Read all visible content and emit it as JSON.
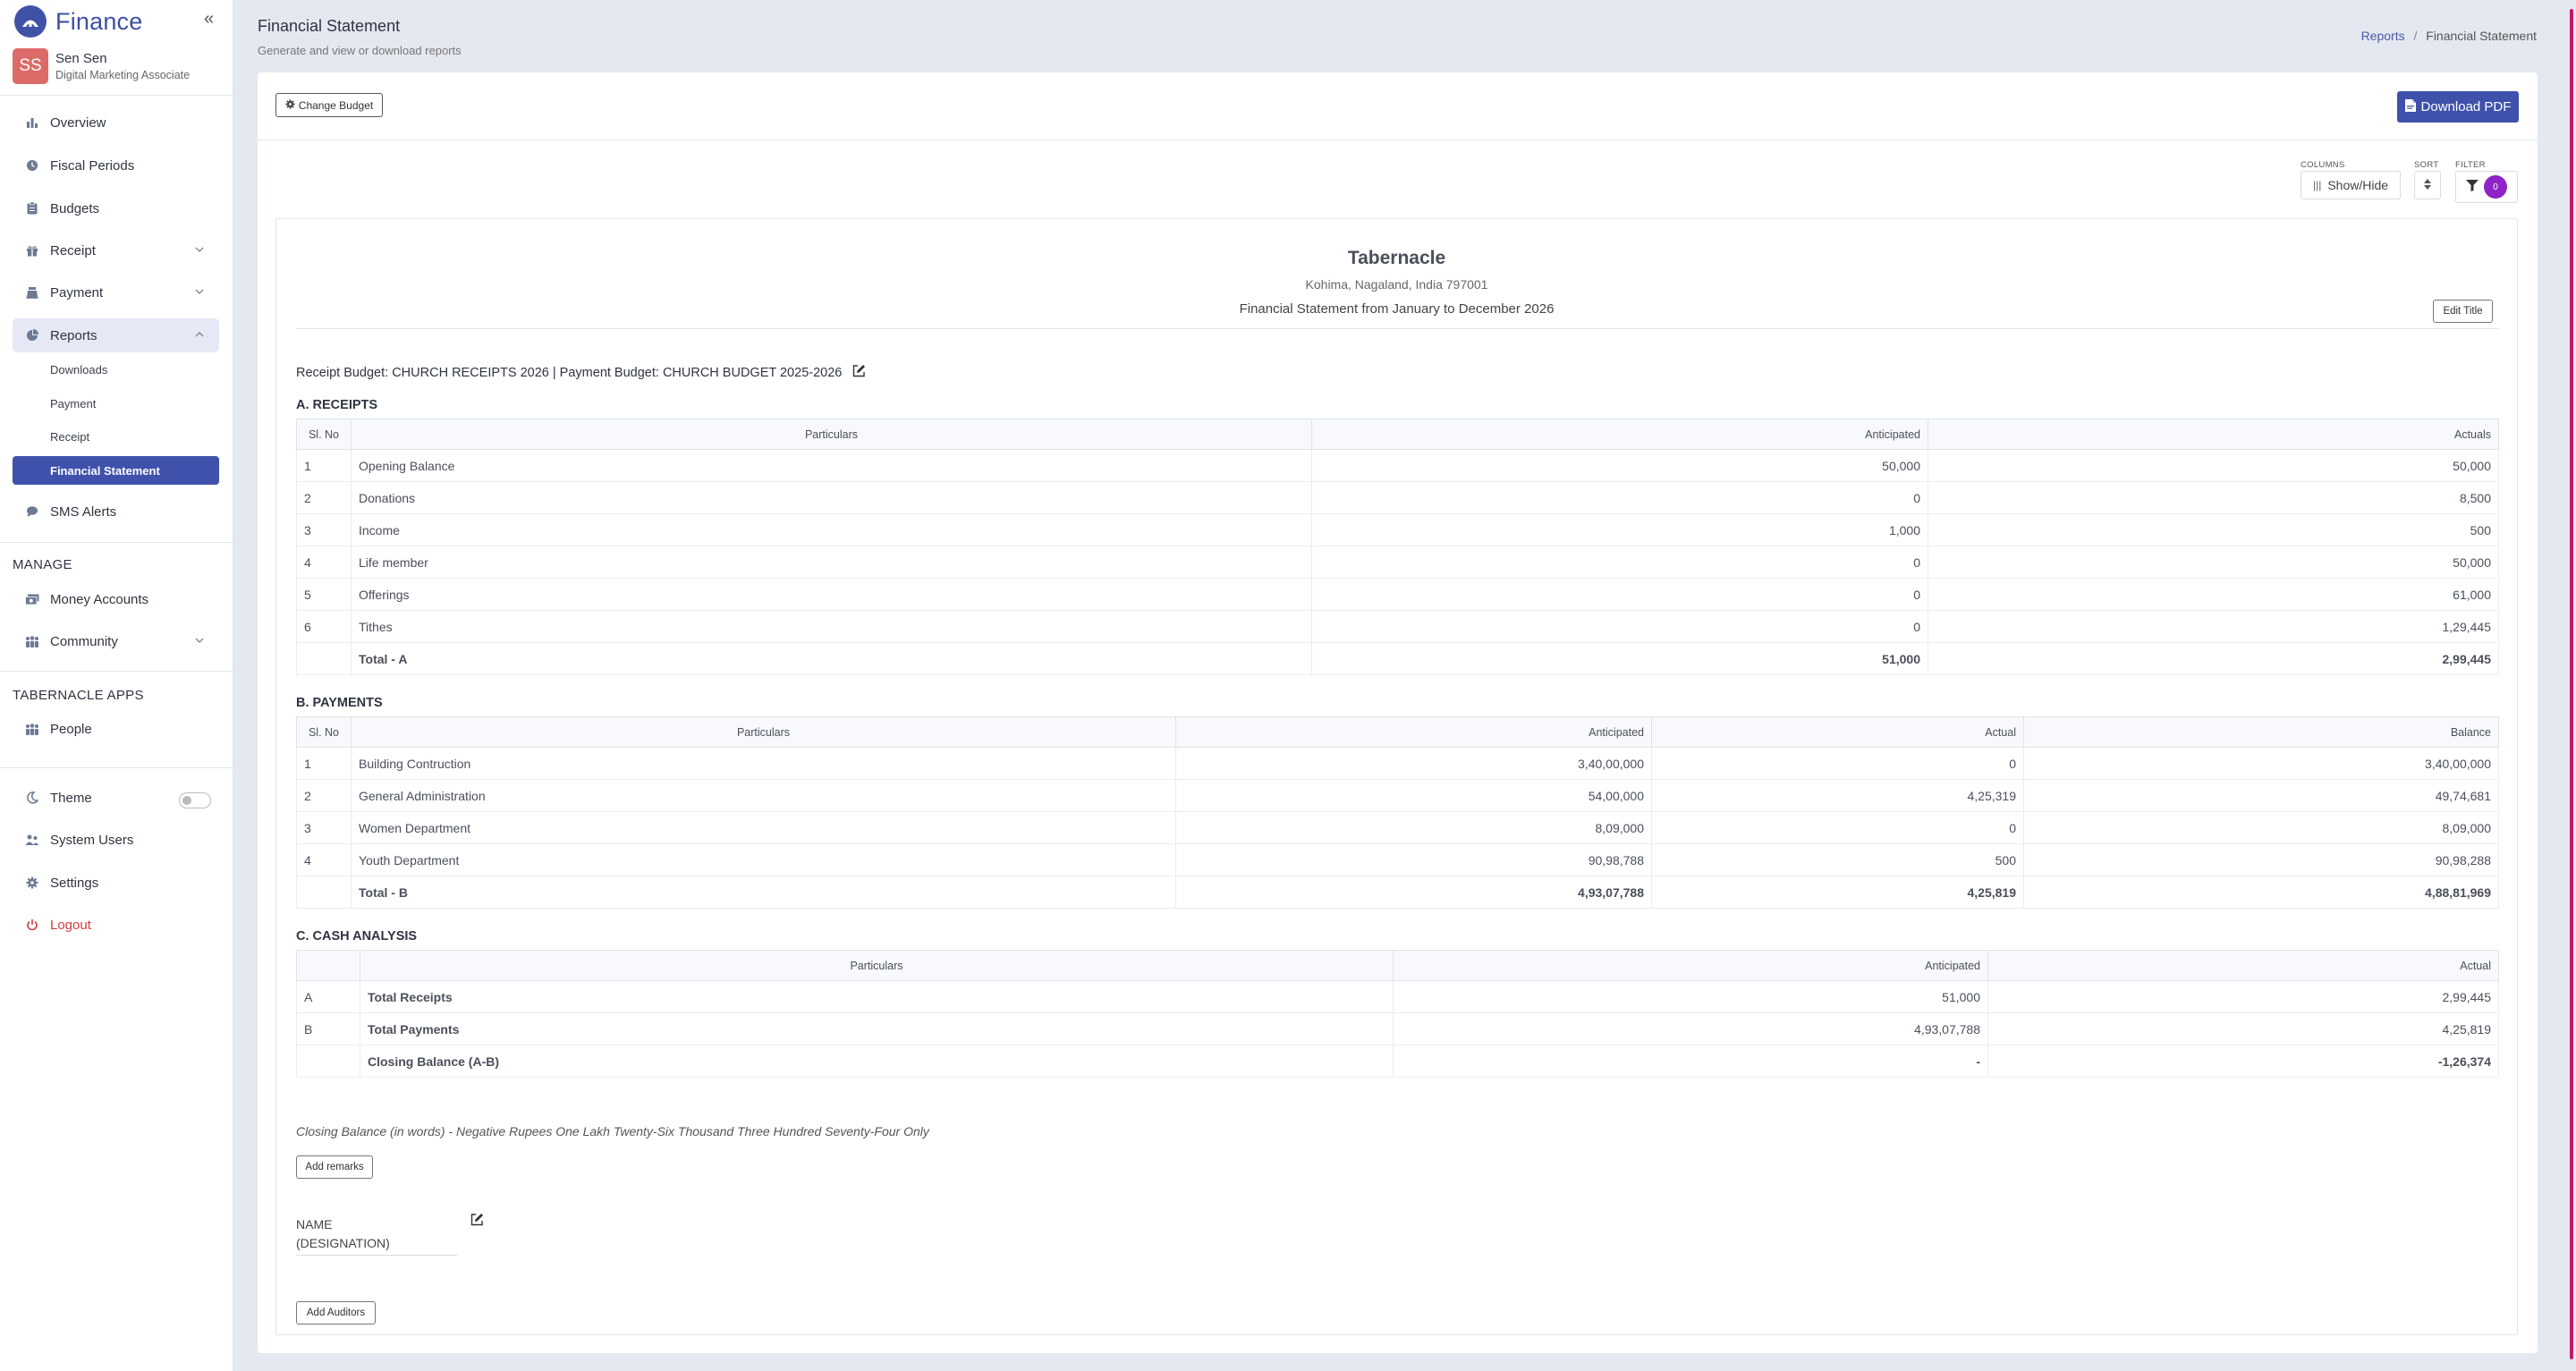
{
  "app": {
    "name": "Finance",
    "brand_color": "#3f51ab"
  },
  "user": {
    "initials": "SS",
    "name": "Sen Sen",
    "role": "Digital Marketing Associate"
  },
  "nav": {
    "overview": "Overview",
    "fiscal_periods": "Fiscal Periods",
    "budgets": "Budgets",
    "receipt": "Receipt",
    "payment": "Payment",
    "reports": "Reports",
    "reports_sub": [
      "Downloads",
      "Payment",
      "Receipt",
      "Financial Statement"
    ],
    "sms_alerts": "SMS Alerts",
    "manage_title": "MANAGE",
    "money_accounts": "Money Accounts",
    "community": "Community",
    "apps_title": "TABERNACLE APPS",
    "people": "People",
    "theme": "Theme",
    "system_users": "System Users",
    "settings": "Settings",
    "logout": "Logout"
  },
  "page": {
    "title": "Financial Statement",
    "subtitle": "Generate and view or download reports",
    "breadcrumb": [
      "Reports",
      "/",
      "Financial Statement"
    ]
  },
  "toolbar": {
    "change_budget": "Change Budget",
    "download_pdf": "Download PDF",
    "columns_label": "COLUMNS",
    "show_hide": "Show/Hide",
    "sort_label": "SORT",
    "filter_label": "FILTER",
    "filter_count": "0"
  },
  "statement": {
    "org_name": "Tabernacle",
    "address": "Kohima, Nagaland, India 797001",
    "period": "Financial Statement from January to December 2026",
    "edit_title": "Edit Title",
    "budget_line": "Receipt Budget: CHURCH RECEIPTS 2026 | Payment Budget: CHURCH BUDGET 2025-2026",
    "receipts_title": "A. RECEIPTS",
    "receipts_headers": [
      "Sl. No",
      "Particulars",
      "Anticipated",
      "Actuals"
    ],
    "receipts_rows": [
      [
        "1",
        "Opening Balance",
        "50,000",
        "50,000"
      ],
      [
        "2",
        "Donations",
        "0",
        "8,500"
      ],
      [
        "3",
        "Income",
        "1,000",
        "500"
      ],
      [
        "4",
        "Life member",
        "0",
        "50,000"
      ],
      [
        "5",
        "Offerings",
        "0",
        "61,000"
      ],
      [
        "6",
        "Tithes",
        "0",
        "1,29,445"
      ]
    ],
    "receipts_total": [
      "",
      "Total - A",
      "51,000",
      "2,99,445"
    ],
    "payments_title": "B. PAYMENTS",
    "payments_headers": [
      "Sl. No",
      "Particulars",
      "Anticipated",
      "Actual",
      "Balance"
    ],
    "payments_rows": [
      [
        "1",
        "Building Contruction",
        "3,40,00,000",
        "0",
        "3,40,00,000"
      ],
      [
        "2",
        "General Administration",
        "54,00,000",
        "4,25,319",
        "49,74,681"
      ],
      [
        "3",
        "Women Department",
        "8,09,000",
        "0",
        "8,09,000"
      ],
      [
        "4",
        "Youth Department",
        "90,98,788",
        "500",
        "90,98,288"
      ]
    ],
    "payments_total": [
      "",
      "Total - B",
      "4,93,07,788",
      "4,25,819",
      "4,88,81,969"
    ],
    "cash_title": "C. CASH ANALYSIS",
    "cash_headers": [
      "",
      "Particulars",
      "Anticipated",
      "Actual"
    ],
    "cash_rows": [
      [
        "A",
        "Total Receipts",
        "51,000",
        "2,99,445"
      ],
      [
        "B",
        "Total Payments",
        "4,93,07,788",
        "4,25,819"
      ]
    ],
    "cash_total": [
      "",
      "Closing Balance (A-B)",
      "-",
      "-1,26,374"
    ],
    "closing_words": "Closing Balance (in words) - Negative Rupees One Lakh Twenty-Six Thousand Three Hundred Seventy-Four Only",
    "add_remarks": "Add remarks",
    "signatory_name": "NAME",
    "signatory_designation": "(DESIGNATION)",
    "add_auditors": "Add Auditors"
  }
}
